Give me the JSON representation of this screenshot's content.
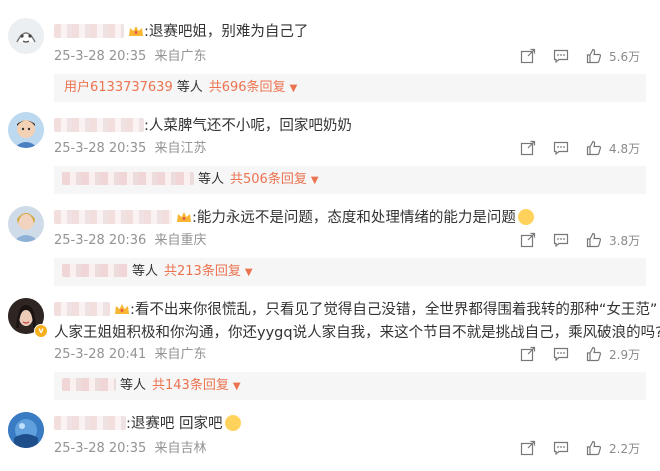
{
  "comments": [
    {
      "text": ":退赛吧姐，别难为自己了",
      "date": "25-3-28 20:35",
      "location": "来自广东",
      "likes": "5.6万",
      "reply": {
        "user": "用户6133737639",
        "deng": "等人",
        "count": "共696条回复"
      }
    },
    {
      "text": ":人菜脾气还不小呢，回家吧奶奶",
      "date": "25-3-28 20:35",
      "location": "来自江苏",
      "likes": "4.8万",
      "reply": {
        "deng": "等人",
        "count": "共506条回复"
      }
    },
    {
      "text": ":能力永远不是问题，态度和处理情绪的能力是问题",
      "date": "25-3-28 20:36",
      "location": "来自重庆",
      "likes": "3.8万",
      "reply": {
        "deng": "等人",
        "count": "共213条回复"
      }
    },
    {
      "text_line1": ":看不出来你很慌乱，只看见了觉得自己没错，全世界都得围着我转的那种“女王范”",
      "text_line2": "人家王姐姐积极和你沟通，你还yygq说人家自我，来这个节目不就是挑战自己，乘风破浪的吗?",
      "date": "25-3-28 20:41",
      "location": "来自广东",
      "likes": "2.9万",
      "reply": {
        "deng": "等人",
        "count": "共143条回复"
      }
    },
    {
      "text": ":退赛吧 回家吧",
      "date": "25-3-28 20:35",
      "location": "来自吉林",
      "likes": "2.2万"
    }
  ],
  "icons": {
    "share": "share-icon",
    "comment": "comment-icon",
    "like": "thumbs-up-icon",
    "caret": "▼"
  },
  "colors": {
    "accent": "#eb7350",
    "meta": "#939393",
    "reply_bg": "#f6f6f6"
  }
}
